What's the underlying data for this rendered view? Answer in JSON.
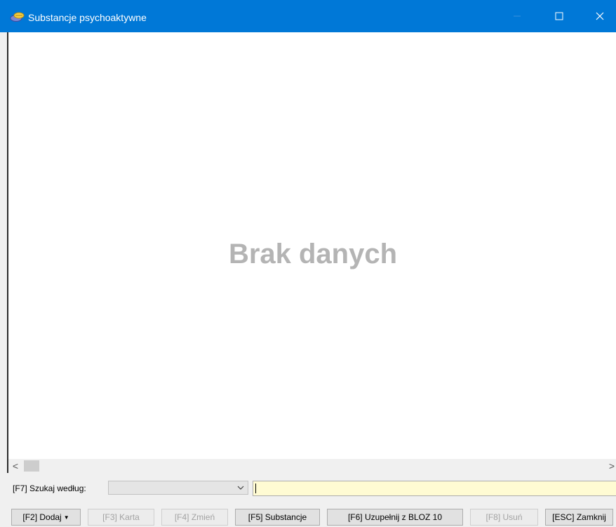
{
  "window": {
    "title": "Substancje psychoaktywne",
    "icon": "pills-icon",
    "controls": [
      "minimize",
      "maximize",
      "close"
    ]
  },
  "grid": {
    "empty_message": "Brak danych"
  },
  "scrollbar": {
    "left_glyph": "<",
    "right_glyph": ">"
  },
  "search": {
    "label": "[F7] Szukaj według:",
    "field_value": "",
    "query_value": ""
  },
  "toolbar": {
    "add": "[F2] Dodaj",
    "card": "[F3] Karta",
    "edit": "[F4] Zmień",
    "substances": "[F5] Substancje",
    "complete_bloz": "[F6] Uzupełnij z BLOZ 10",
    "delete": "[F8] Usuń",
    "close": "[ESC] Zamknij"
  },
  "colors": {
    "titlebar": "#0078d7",
    "search_input_bg": "#fffbd3",
    "empty_text": "#b4b4b4"
  }
}
